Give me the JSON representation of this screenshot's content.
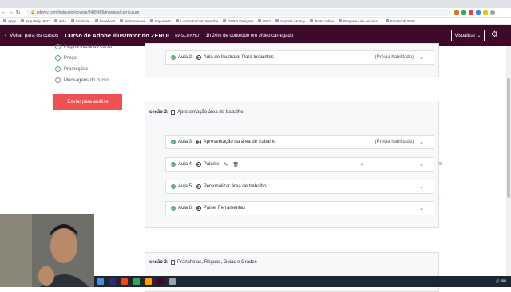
{
  "browser": {
    "url": "udemy.com/instructor/course/3495405/manage/curriculum",
    "bookmarks": [
      "Apps",
      "Arquitetiy VDC",
      "Aula",
      "Cristiane",
      "Facebook",
      "Ferramentas",
      "Importado",
      "Lucrando Com Youtube",
      "DSRO Designer",
      "SEO",
      "Suporte iHonny",
      "Teste online",
      "Programa de Associa...",
      "Facebook 2020"
    ]
  },
  "header": {
    "back_label": "Voltar para os cursos",
    "course_title": "Curso de Adobe Illustrator do ZERO!",
    "status": "RASCUNHO",
    "video_time": "1h 20m de conteúdo em vídeo carregado",
    "view_label": "Visualizar",
    "accent": "#3d0a2c"
  },
  "sidebar": {
    "items": [
      {
        "label": "Página inicial do curso",
        "done": true
      },
      {
        "label": "Preço",
        "done": true
      },
      {
        "label": "Promoções",
        "done": true
      },
      {
        "label": "Mensagens do curso",
        "done": false
      }
    ],
    "submit_label": "Enviar para análise",
    "submit_color": "#ec5252"
  },
  "curriculum": {
    "top_lecture": {
      "label": "Aula 2:",
      "title": "Aula de Illustrator Para Iniciantes",
      "preview": "(Prévia habilitada)"
    },
    "section2": {
      "label": "seção 2:",
      "title": "Apresentação área de trabalho",
      "lectures": [
        {
          "label": "Aula 3:",
          "title": "Apresentação da área de trabalho",
          "preview": "(Prévia habilitada)"
        },
        {
          "label": "Aula 4:",
          "title": "Painéis",
          "preview": ""
        },
        {
          "label": "Aula 5:",
          "title": "Personalizar área de trabalho",
          "preview": ""
        },
        {
          "label": "Aula 6:",
          "title": "Painel Ferramentas",
          "preview": ""
        }
      ]
    },
    "section3": {
      "label": "seção 3:",
      "title": "Pranchetas, Réguas, Guias e Grades"
    }
  },
  "icons": [
    "back-arrow-icon",
    "gear-icon",
    "check-icon",
    "play-icon",
    "document-icon",
    "chevron-down-icon",
    "pencil-icon",
    "trash-icon",
    "drag-handle-icon"
  ]
}
